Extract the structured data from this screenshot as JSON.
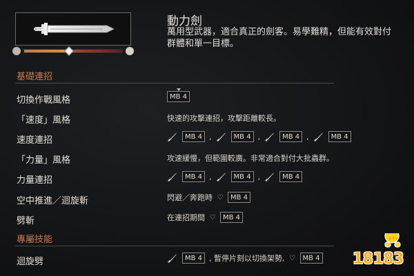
{
  "weapon": {
    "title": "動力劍",
    "description": "萬用型武器，適合真正的劍客。易學難精，但能有效對付群體和單一目標。",
    "mastery_progress_percent": 46
  },
  "sections": [
    {
      "title": "基礎連招",
      "rows": [
        {
          "label": "切換作戰風格",
          "value": [
            {
              "type": "mb",
              "text": "MB 4",
              "tick": true
            }
          ]
        },
        {
          "label": "「速度」風格",
          "value": [
            {
              "type": "text",
              "text": "快速的攻擊連招，攻擊距離較長。"
            }
          ]
        },
        {
          "label": "速度連招",
          "value": [
            {
              "type": "sword"
            },
            {
              "type": "mb",
              "text": "MB 4"
            },
            {
              "type": "text",
              "text": ","
            },
            {
              "type": "sword"
            },
            {
              "type": "mb",
              "text": "MB 4"
            },
            {
              "type": "text",
              "text": ","
            },
            {
              "type": "sword"
            },
            {
              "type": "mb",
              "text": "MB 4"
            },
            {
              "type": "text",
              "text": ","
            },
            {
              "type": "sword"
            },
            {
              "type": "mb",
              "text": "MB 4"
            }
          ]
        },
        {
          "label": "「力量」風格",
          "value": [
            {
              "type": "text",
              "text": "攻速緩慢，但範圍較廣。非常適合對付大批蟲群。"
            }
          ]
        },
        {
          "label": "力量連招",
          "value": [
            {
              "type": "sword"
            },
            {
              "type": "mb",
              "text": "MB 4"
            },
            {
              "type": "text",
              "text": ","
            },
            {
              "type": "sword"
            },
            {
              "type": "mb",
              "text": "MB 4"
            },
            {
              "type": "text",
              "text": ","
            },
            {
              "type": "sword"
            },
            {
              "type": "mb",
              "text": "MB 4"
            }
          ]
        },
        {
          "label": "空中推進／迴旋斬",
          "value": [
            {
              "type": "text",
              "text": "閃避／奔跑時"
            },
            {
              "type": "heart"
            },
            {
              "type": "mb",
              "text": "MB 4"
            }
          ]
        },
        {
          "label": "劈斬",
          "value": [
            {
              "type": "text",
              "text": "在連招期間"
            },
            {
              "type": "heart"
            },
            {
              "type": "mb",
              "text": "MB 4"
            }
          ]
        }
      ]
    },
    {
      "title": "專屬技能",
      "rows": [
        {
          "label": "迴旋劈",
          "value": [
            {
              "type": "sword"
            },
            {
              "type": "mb",
              "text": "MB 4"
            },
            {
              "type": "text",
              "text": ", 暫停片刻以切換架勢,"
            },
            {
              "type": "heart"
            },
            {
              "type": "mb",
              "text": "MB 4"
            }
          ]
        }
      ]
    }
  ],
  "watermark": {
    "text": "18183"
  },
  "icons": {
    "skull": "skull-icon",
    "sword": "sword-icon",
    "heart": "broken-heart-icon"
  }
}
